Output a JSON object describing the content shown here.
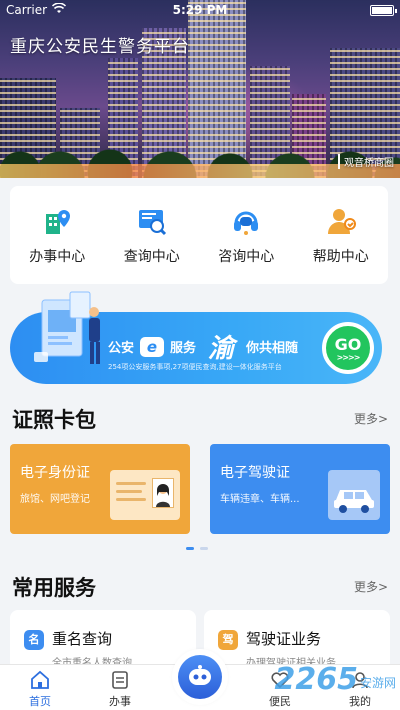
{
  "status_bar": {
    "carrier": "Carrier",
    "time": "5:29 PM"
  },
  "hero": {
    "title": "重庆公安民生警务平台",
    "location": "观音桥商圈"
  },
  "services": [
    {
      "label": "办事中心",
      "icon": "building-pin-icon"
    },
    {
      "label": "查询中心",
      "icon": "search-screen-icon"
    },
    {
      "label": "咨询中心",
      "icon": "headset-icon"
    },
    {
      "label": "帮助中心",
      "icon": "person-help-icon"
    }
  ],
  "banner": {
    "part1": "公安",
    "e_badge": "e",
    "part2": "服务",
    "yu": "渝",
    "part3": "你共相随",
    "sub": "254项公安服务事项,27项便民查询,建设一体化服务平台",
    "go": "GO",
    "go_arrows": ">>>>"
  },
  "cert_section": {
    "title": "证照卡包",
    "more": "更多>"
  },
  "certs": [
    {
      "title": "电子身份证",
      "subtitle": "旅馆、网吧登记",
      "color": "#f0a63a"
    },
    {
      "title": "电子驾驶证",
      "subtitle": "车辆违章、车辆...",
      "color": "#3d8df0"
    }
  ],
  "common_section": {
    "title": "常用服务",
    "more": "更多>"
  },
  "common_services": [
    {
      "badge": "名",
      "title": "重名查询",
      "subtitle": "全市重名人数查询",
      "color": "#3d8df0"
    },
    {
      "badge": "驾",
      "title": "驾驶证业务",
      "subtitle": "办理驾驶证相关业务",
      "color": "#f0a63a"
    }
  ],
  "tabs": [
    {
      "label": "首页",
      "icon": "home-icon",
      "active": true
    },
    {
      "label": "办事",
      "icon": "document-icon",
      "active": false
    },
    {
      "label": "便民",
      "icon": "heart-icon",
      "active": false
    },
    {
      "label": "我的",
      "icon": "user-icon",
      "active": false
    }
  ],
  "watermark": {
    "big": "2265",
    "small": "安游网"
  },
  "colors": {
    "primary": "#2d6fdf",
    "banner_blue": "#2d8ef2",
    "go_green": "#22c55e"
  }
}
